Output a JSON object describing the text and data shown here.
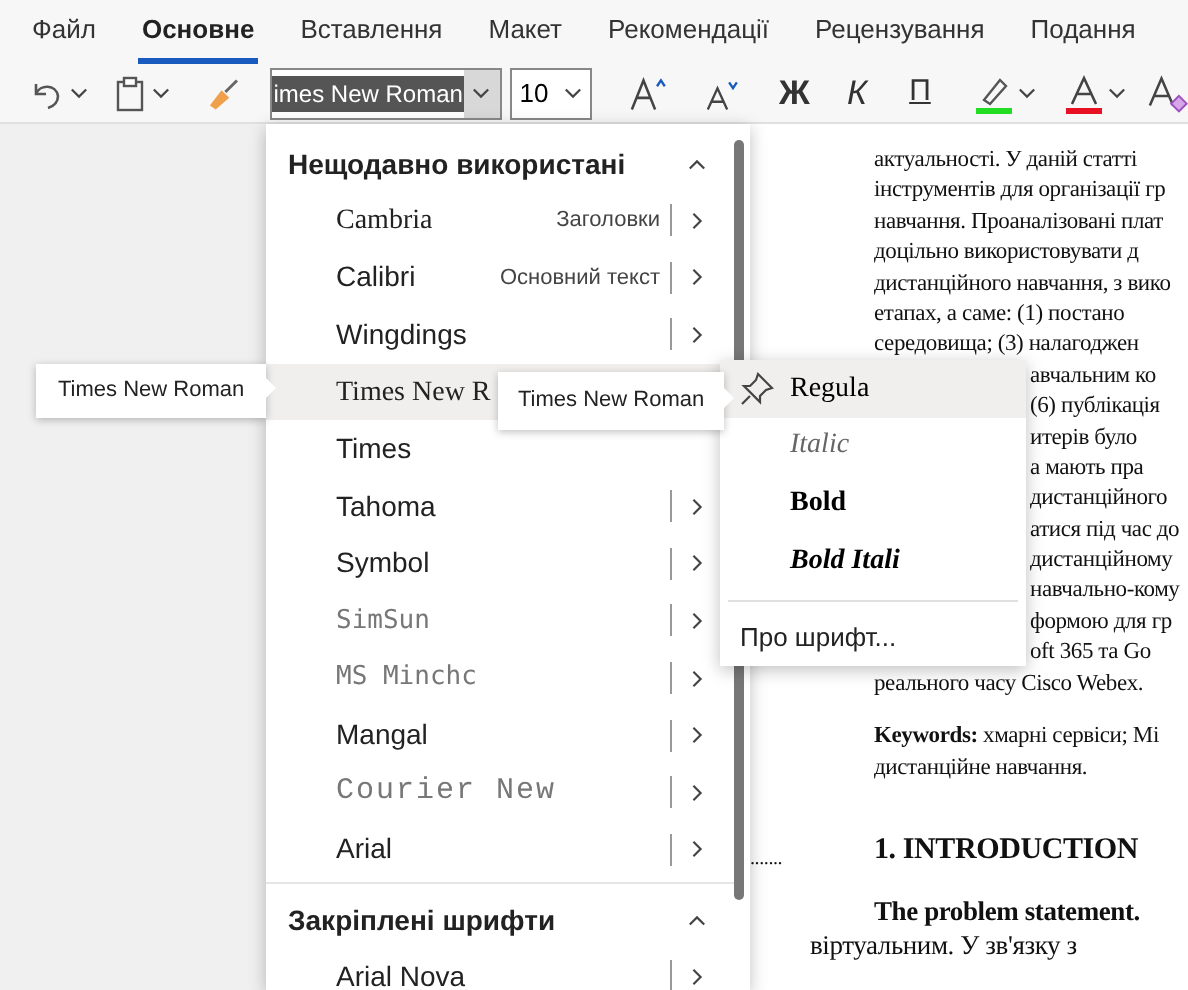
{
  "tabs": [
    {
      "label": "Файл",
      "selected": false
    },
    {
      "label": "Основне",
      "selected": true
    },
    {
      "label": "Вставлення",
      "selected": false
    },
    {
      "label": "Макет",
      "selected": false
    },
    {
      "label": "Рекомендації",
      "selected": false
    },
    {
      "label": "Рецензування",
      "selected": false
    },
    {
      "label": "Подання",
      "selected": false
    }
  ],
  "toolbar": {
    "font_name": "imes New Roman",
    "font_size": "10",
    "bold": "Ж",
    "italic": "К",
    "underline": "П"
  },
  "font_menu": {
    "sections": [
      {
        "title": "Нещодавно використані",
        "expanded": true,
        "items": [
          {
            "name": "Cambria",
            "kind": "serif",
            "note": "Заголовки",
            "arrow": true,
            "selected": false
          },
          {
            "name": "Calibri",
            "kind": "sans",
            "note": "Основний текст",
            "arrow": true,
            "selected": false
          },
          {
            "name": "Wingdings",
            "kind": "sans",
            "arrow": true,
            "selected": false
          },
          {
            "name": "Times New R",
            "kind": "serif",
            "arrow": false,
            "selected": true
          },
          {
            "name": "Times",
            "kind": "sans",
            "arrow": false,
            "selected": false
          },
          {
            "name": "Tahoma",
            "kind": "sans",
            "arrow": true,
            "selected": false
          },
          {
            "name": "Symbol",
            "kind": "sans",
            "arrow": true,
            "selected": false
          },
          {
            "name": "SimSun",
            "kind": "cjk",
            "arrow": true,
            "selected": false
          },
          {
            "name": "MS Minchc",
            "kind": "cjk",
            "arrow": true,
            "selected": false
          },
          {
            "name": "Mangal",
            "kind": "sans",
            "arrow": true,
            "selected": false
          },
          {
            "name": "Courier New",
            "kind": "mono",
            "arrow": true,
            "selected": false
          },
          {
            "name": "Arial",
            "kind": "sans",
            "arrow": true,
            "selected": false
          }
        ]
      },
      {
        "title": "Закріплені шрифти",
        "expanded": true,
        "items": [
          {
            "name": "Arial Nova",
            "kind": "sans",
            "arrow": true,
            "selected": false
          }
        ]
      }
    ]
  },
  "tooltips": [
    "Times New Roman",
    "Times New Roman"
  ],
  "style_menu": {
    "items": [
      {
        "label": "Regula",
        "kind": "regular",
        "selected": true
      },
      {
        "label": "Italic",
        "kind": "italic",
        "selected": false
      },
      {
        "label": "Bold",
        "kind": "bold",
        "selected": false
      },
      {
        "label": "Bold Itali",
        "kind": "bold-italic",
        "selected": false
      }
    ],
    "about": "Про шрифт..."
  },
  "document": {
    "lines": [
      {
        "text": "актуальності. У даній статті",
        "kind": "full"
      },
      {
        "text": "інструментів для організації гр",
        "kind": "full"
      },
      {
        "text": "навчання. Проаналізовані плат",
        "kind": "full"
      },
      {
        "text": "доцільно використовувати д",
        "kind": "full"
      },
      {
        "text": "дистанційного навчання, з вико",
        "kind": "full"
      },
      {
        "text": "етапах, а саме: (1) постано",
        "kind": "full"
      },
      {
        "text": "середовища; (3) налагоджен",
        "kind": "full"
      },
      {
        "text": "авчальним ко",
        "kind": "fragment"
      },
      {
        "text": "(6) публікація",
        "kind": "fragment"
      },
      {
        "text": "итерів було",
        "kind": "fragment"
      },
      {
        "text": "а мають пра",
        "kind": "fragment"
      },
      {
        "text": "дистанційного",
        "kind": "fragment"
      },
      {
        "text": "атися під час до",
        "kind": "fragment"
      },
      {
        "text": "дистанційному",
        "kind": "fragment"
      },
      {
        "text": "навчально-кому",
        "kind": "fragment"
      },
      {
        "text": "формою для гр",
        "kind": "fragment"
      },
      {
        "text": "oft 365 та Go",
        "kind": "fragment"
      },
      {
        "text": "реального часу Cisco Webex.",
        "kind": "full"
      }
    ],
    "keywords": "**Keywords:** хмарні сервіси; Mi",
    "keywords_2": "дистанційне навчання.",
    "dots": ".......",
    "heading": "1. INTRODUCTION",
    "para_bold": "The problem statement.",
    "para_2": "віртуальним. У зв'язку з"
  }
}
